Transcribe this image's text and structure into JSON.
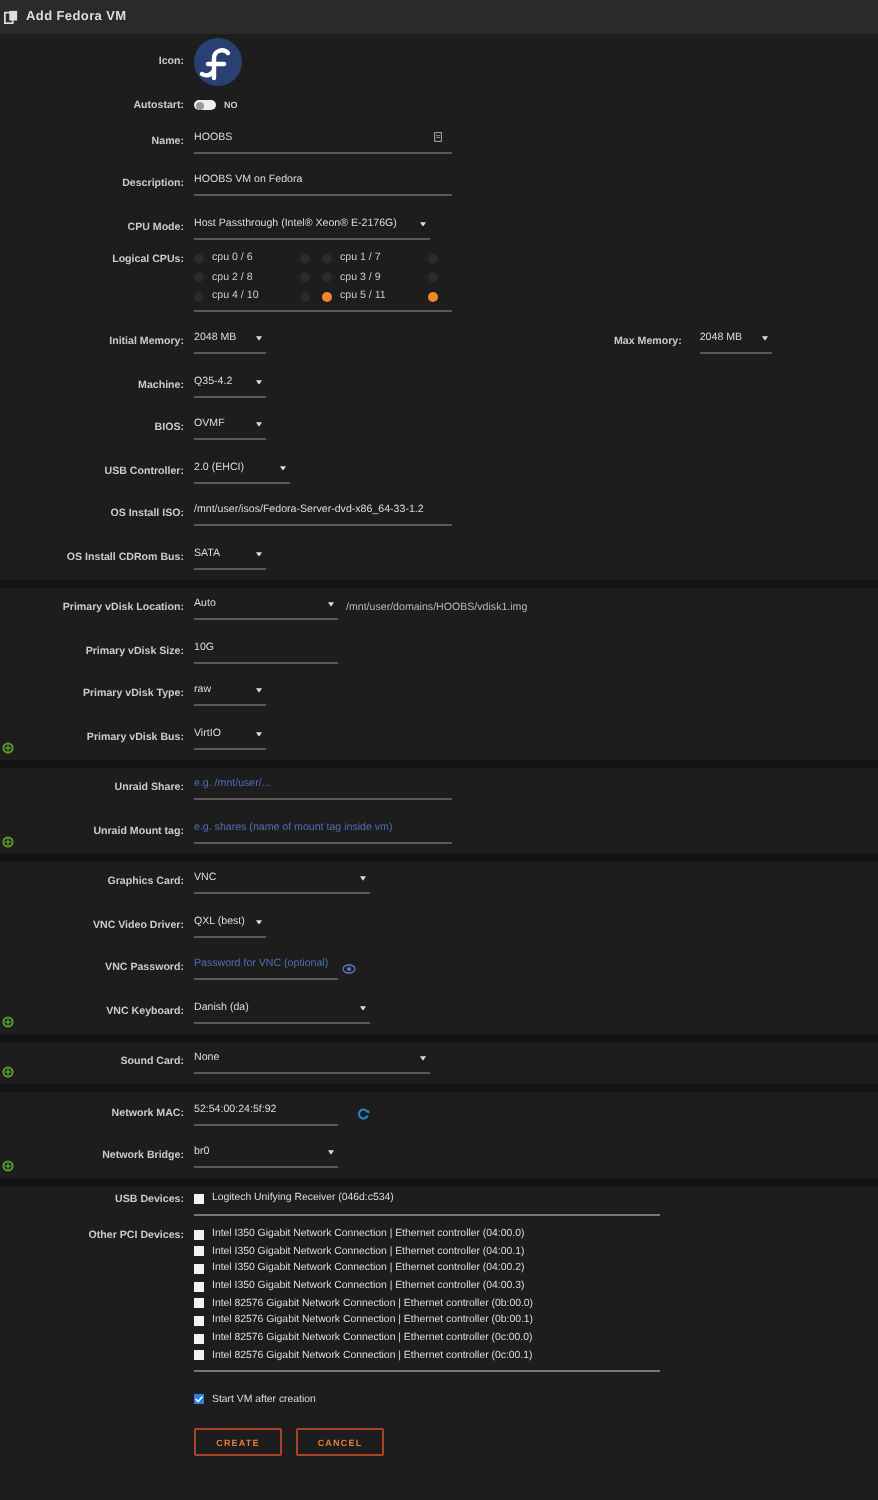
{
  "window": {
    "title": "Add Fedora VM"
  },
  "sections": [
    {
      "add_icon": false,
      "rows": [
        {
          "kind": "icon",
          "label": "Icon:"
        },
        {
          "kind": "toggle",
          "label": "Autostart:",
          "on": false,
          "value": "NO"
        },
        {
          "kind": "text_copy",
          "label": "Name:",
          "value": "HOOBS"
        },
        {
          "kind": "text",
          "label": "Description:",
          "value": "HOOBS VM on Fedora"
        },
        {
          "kind": "select",
          "label": "CPU Mode:",
          "value": "Host Passthrough (Intel® Xeon® E-2176G)"
        },
        {
          "kind": "cpus",
          "label": "Logical CPUs:",
          "cpus": [
            {
              "label": "cpu 0 / 6",
              "selected": false
            },
            {
              "label": "cpu 1 / 7",
              "selected": false
            },
            {
              "label": "cpu 2 / 8",
              "selected": false
            },
            {
              "label": "cpu 3 / 9",
              "selected": false
            },
            {
              "label": "cpu 4 / 10",
              "selected": false
            },
            {
              "label": "cpu 5 / 11",
              "selected": true
            }
          ]
        },
        {
          "kind": "memory",
          "label": "Initial Memory:",
          "value": "2048 MB",
          "label2": "Max Memory:",
          "value2": "2048 MB"
        },
        {
          "kind": "select",
          "label": "Machine:",
          "value": "Q35-4.2"
        },
        {
          "kind": "select",
          "label": "BIOS:",
          "value": "OVMF"
        },
        {
          "kind": "select",
          "label": "USB Controller:",
          "value": "2.0 (EHCI)"
        },
        {
          "kind": "text",
          "label": "OS Install ISO:",
          "value": "/mnt/user/isos/Fedora-Server-dvd-x86_64-33-1.2"
        },
        {
          "kind": "select",
          "label": "OS Install CDRom Bus:",
          "value": "SATA"
        }
      ]
    },
    {
      "add_icon": true,
      "rows": [
        {
          "kind": "select_note",
          "label": "Primary vDisk Location:",
          "value": "Auto",
          "note": "/mnt/user/domains/HOOBS/vdisk1.img"
        },
        {
          "kind": "text",
          "label": "Primary vDisk Size:",
          "value": "10G"
        },
        {
          "kind": "select",
          "label": "Primary vDisk Type:",
          "value": "raw"
        },
        {
          "kind": "select",
          "label": "Primary vDisk Bus:",
          "value": "VirtIO"
        }
      ]
    },
    {
      "add_icon": true,
      "rows": [
        {
          "kind": "input",
          "label": "Unraid Share:",
          "placeholder": "e.g. /mnt/user/..."
        },
        {
          "kind": "input",
          "label": "Unraid Mount tag:",
          "placeholder": "e.g. shares (name of mount tag inside vm)"
        }
      ]
    },
    {
      "add_icon": true,
      "rows": [
        {
          "kind": "select",
          "label": "Graphics Card:",
          "value": "VNC"
        },
        {
          "kind": "select",
          "label": "VNC Video Driver:",
          "value": "QXL (best)"
        },
        {
          "kind": "password",
          "label": "VNC Password:",
          "placeholder": "Password for VNC (optional)"
        },
        {
          "kind": "select",
          "label": "VNC Keyboard:",
          "value": "Danish (da)"
        }
      ]
    },
    {
      "add_icon": true,
      "rows": [
        {
          "kind": "select",
          "label": "Sound Card:",
          "value": "None"
        }
      ]
    },
    {
      "add_icon": true,
      "rows": [
        {
          "kind": "mac",
          "label": "Network MAC:",
          "value": "52:54:00:24:5f:92"
        },
        {
          "kind": "select",
          "label": "Network Bridge:",
          "value": "br0"
        }
      ]
    },
    {
      "add_icon": false,
      "rows": [
        {
          "kind": "devices",
          "label": "USB Devices:",
          "items": [
            {
              "label": "Logitech Unifying Receiver (046d:c534)",
              "checked": false
            }
          ]
        },
        {
          "kind": "devices",
          "label": "Other PCI Devices:",
          "items": [
            {
              "label": "Intel I350 Gigabit Network Connection | Ethernet controller (04:00.0)",
              "checked": false
            },
            {
              "label": "Intel I350 Gigabit Network Connection | Ethernet controller (04:00.1)",
              "checked": false
            },
            {
              "label": "Intel I350 Gigabit Network Connection | Ethernet controller (04:00.2)",
              "checked": false
            },
            {
              "label": "Intel I350 Gigabit Network Connection | Ethernet controller (04:00.3)",
              "checked": false
            },
            {
              "label": "Intel 82576 Gigabit Network Connection | Ethernet controller (0b:00.0)",
              "checked": false
            },
            {
              "label": "Intel 82576 Gigabit Network Connection | Ethernet controller (0b:00.1)",
              "checked": false
            },
            {
              "label": "Intel 82576 Gigabit Network Connection | Ethernet controller (0c:00.0)",
              "checked": false
            },
            {
              "label": "Intel 82576 Gigabit Network Connection | Ethernet controller (0c:00.1)",
              "checked": false
            }
          ]
        },
        {
          "kind": "check",
          "value": "Start VM after creation",
          "checked": true
        },
        {
          "kind": "buttons",
          "buttons": [
            "CREATE",
            "CANCEL"
          ]
        }
      ]
    }
  ]
}
